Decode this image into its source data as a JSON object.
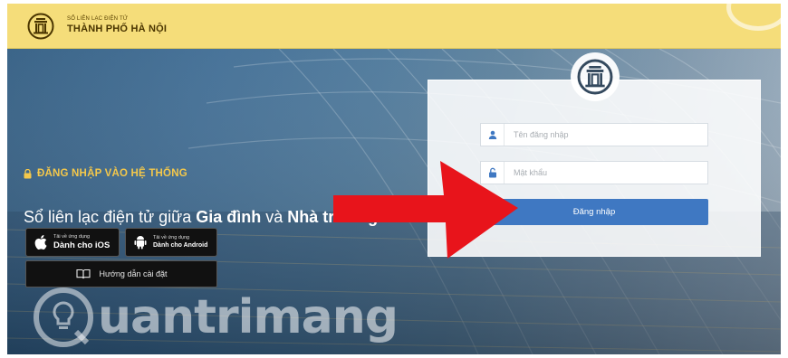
{
  "header": {
    "brand_small": "SỔ LIÊN LẠC ĐIỆN TỬ",
    "brand_large": "THÀNH PHỐ HÀ NỘI"
  },
  "hero": {
    "login_title": "ĐĂNG NHẬP VÀO HỆ THỐNG",
    "tagline_prefix": "Sổ liên lạc điện tử giữa ",
    "tagline_bold1": "Gia đình",
    "tagline_mid": " và ",
    "tagline_bold2": "Nhà trường",
    "ios_small": "Tải về ứng dụng",
    "ios_big": "Dành cho iOS",
    "android_small": "Tải về ứng dụng",
    "android_big": "Dành cho Android",
    "guide_label": "Hướng dẫn cài đặt"
  },
  "login": {
    "username_placeholder": "Tên đăng nhập",
    "username_value": "",
    "password_placeholder": "Mật khẩu",
    "password_value": "",
    "submit_label": "Đăng nhập"
  },
  "watermark": {
    "text": "uantrimang"
  },
  "colors": {
    "header_bg": "#f5dd7a",
    "title_gold": "#f4c84b",
    "button_blue": "#3f78c2",
    "arrow_red": "#e8141b"
  },
  "icons": [
    "city-emblem-icon",
    "lock-icon",
    "apple-icon",
    "android-icon",
    "book-icon",
    "user-icon",
    "padlock-icon",
    "arrow-icon",
    "lightbulb-icon"
  ]
}
